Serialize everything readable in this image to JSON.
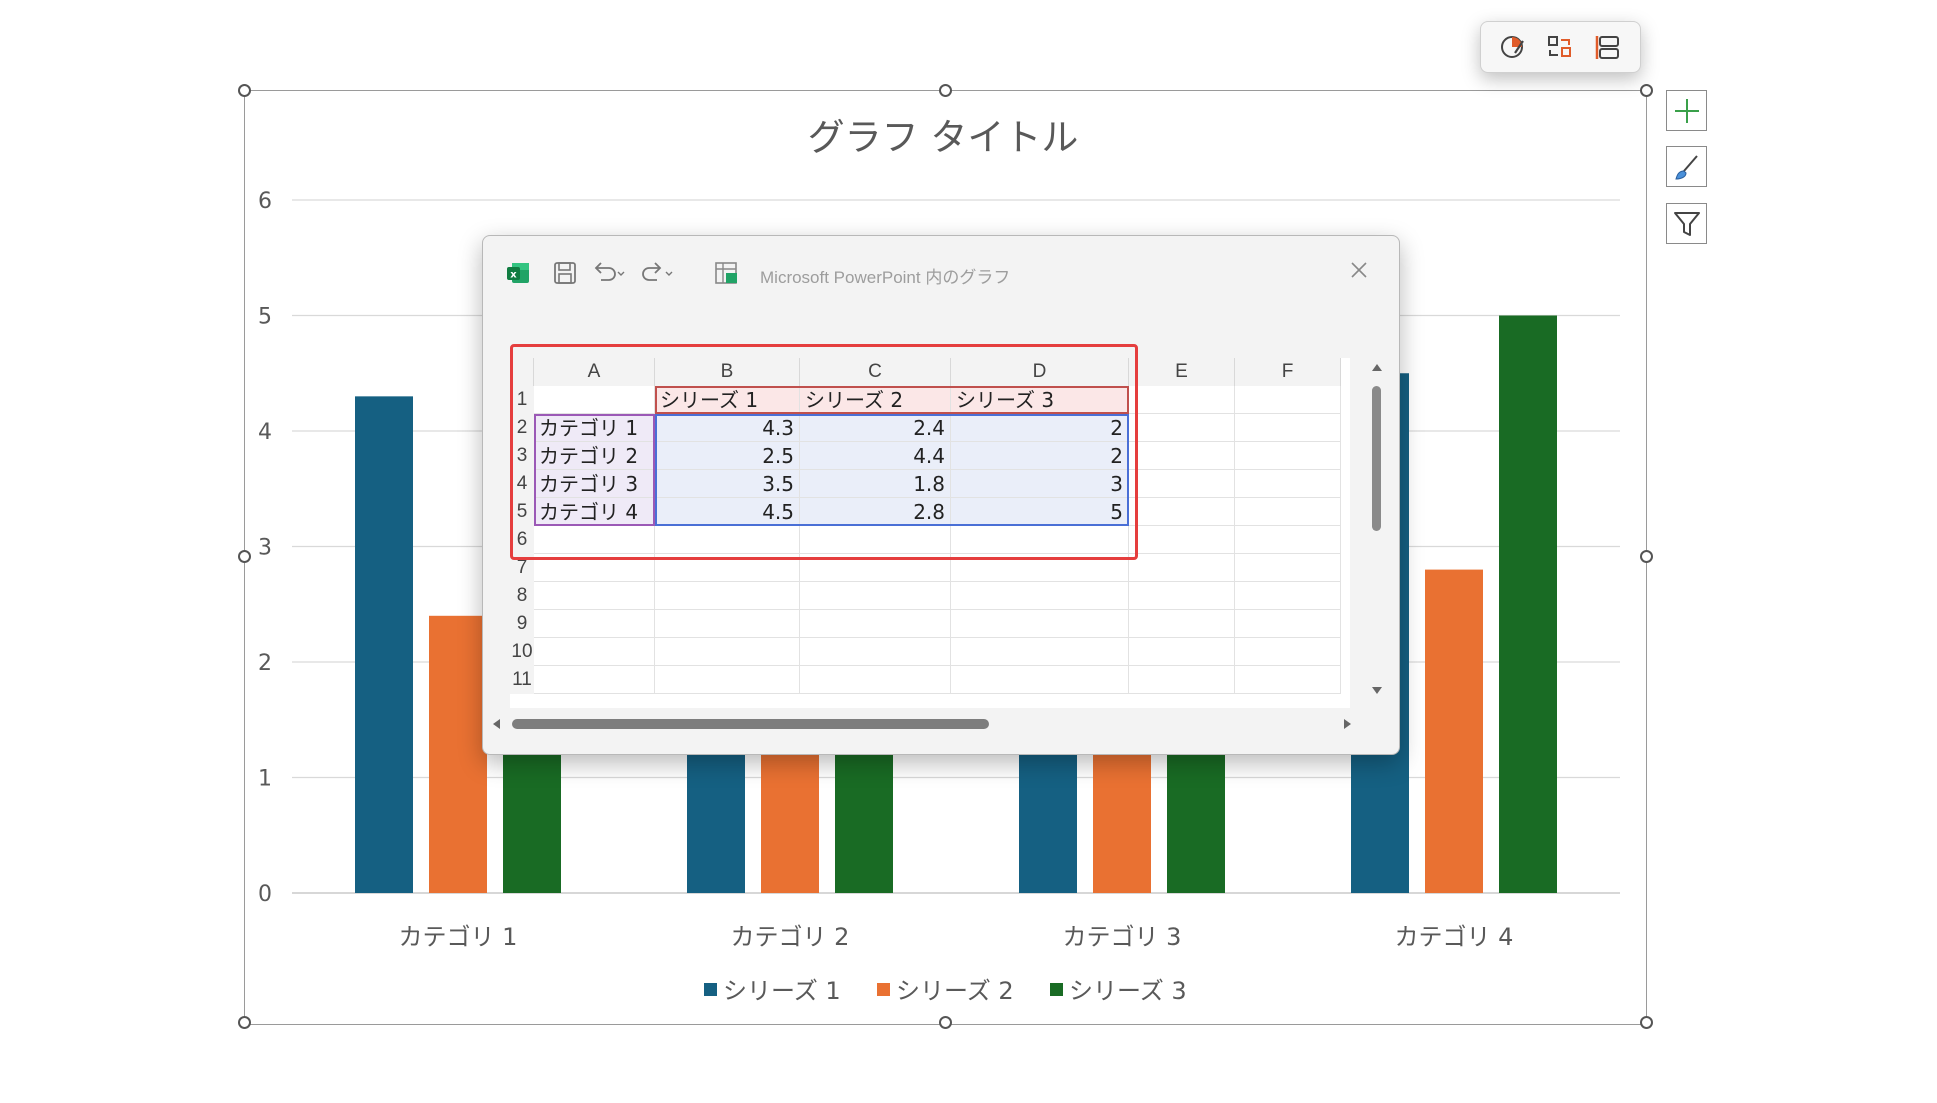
{
  "chart_data": {
    "type": "bar",
    "title": "グラフ タイトル",
    "categories": [
      "カテゴリ 1",
      "カテゴリ 2",
      "カテゴリ 3",
      "カテゴリ 4"
    ],
    "series": [
      {
        "name": "シリーズ 1",
        "values": [
          4.3,
          2.5,
          3.5,
          4.5
        ],
        "color": "#156082"
      },
      {
        "name": "シリーズ 2",
        "values": [
          2.4,
          4.4,
          1.8,
          2.8
        ],
        "color": "#e97132"
      },
      {
        "name": "シリーズ 3",
        "values": [
          2,
          2,
          3,
          5
        ],
        "color": "#196b24"
      }
    ],
    "ylim": [
      0,
      6
    ],
    "yticks": [
      "0",
      "1",
      "2",
      "3",
      "4",
      "5",
      "6"
    ],
    "grid": true,
    "legend": "bottom"
  },
  "excel": {
    "title": "Microsoft PowerPoint 内のグラフ",
    "columns": [
      "A",
      "B",
      "C",
      "D",
      "E",
      "F"
    ],
    "rows": [
      "1",
      "2",
      "3",
      "4",
      "5",
      "6",
      "7",
      "8",
      "9",
      "10",
      "11"
    ],
    "header_row": [
      "",
      "シリーズ 1",
      "シリーズ 2",
      "シリーズ 3"
    ],
    "data_rows": [
      [
        "カテゴリ 1",
        "4.3",
        "2.4",
        "2"
      ],
      [
        "カテゴリ 2",
        "2.5",
        "4.4",
        "2"
      ],
      [
        "カテゴリ 3",
        "3.5",
        "1.8",
        "3"
      ],
      [
        "カテゴリ 4",
        "4.5",
        "2.8",
        "5"
      ]
    ]
  },
  "icons": {
    "top_toolbar": [
      "chart-styles-icon",
      "switch-row-column-icon",
      "layout-icon"
    ],
    "side": [
      "chart-elements-plus-icon",
      "chart-styles-brush-icon",
      "chart-filter-icon"
    ],
    "excel": [
      "excel-logo-icon",
      "save-icon",
      "undo-icon",
      "redo-icon",
      "edit-data-icon",
      "close-icon"
    ]
  },
  "colors": {
    "highlight": "#e53e3e",
    "series_range": "#7a5bbd",
    "category_range": "#9b59b6",
    "value_range": "#4a6fd6"
  }
}
